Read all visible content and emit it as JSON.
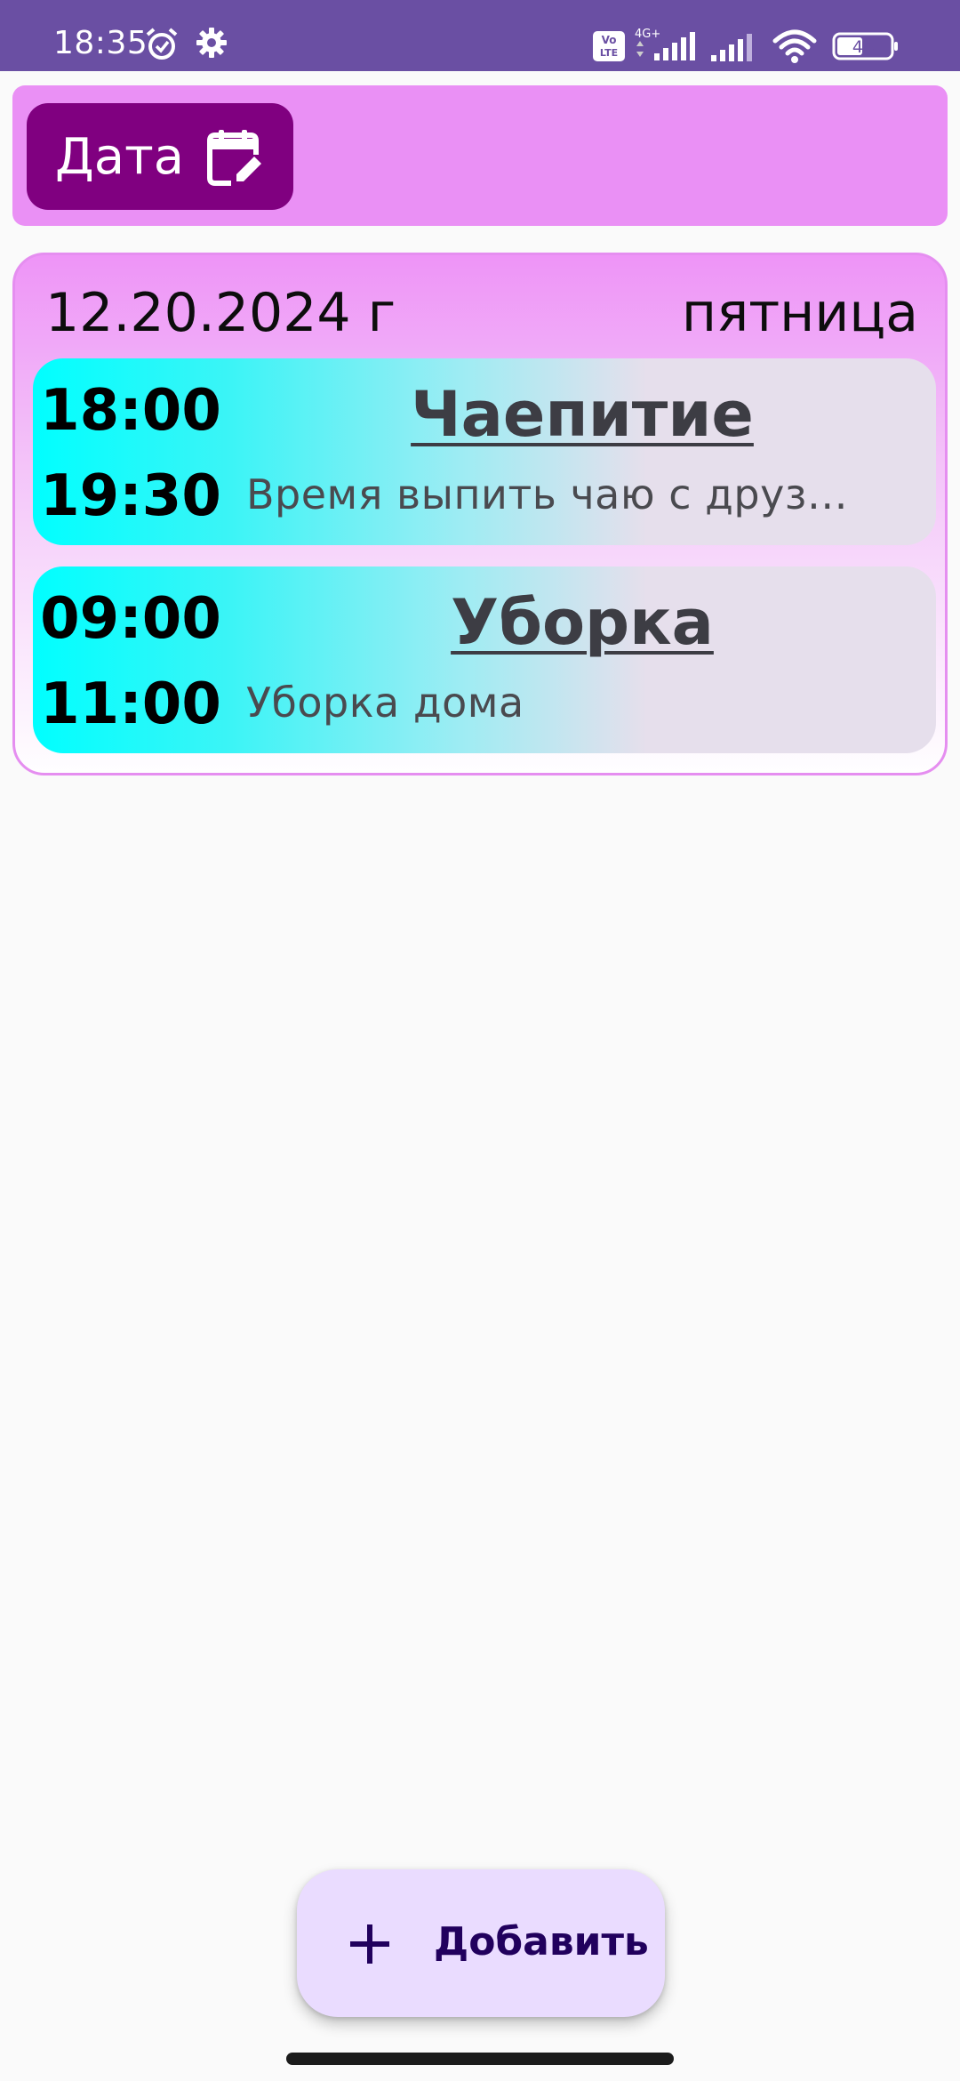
{
  "status_bar": {
    "time": "18:35",
    "network_label": "4G+",
    "volte_label": "Vo LTE",
    "battery_level": "44"
  },
  "header": {
    "date_button_label": "Дата"
  },
  "day": {
    "date": "12.20.2024 г",
    "weekday": "пятница",
    "events": [
      {
        "start": "18:00",
        "end": "19:30",
        "title": "Чаепитие",
        "description": "Время выпить чаю с друзьями"
      },
      {
        "start": "09:00",
        "end": "11:00",
        "title": "Уборка",
        "description": "Уборка дома"
      }
    ]
  },
  "fab": {
    "label": "Добавить"
  },
  "colors": {
    "status_bar": "#6a4fa3",
    "header_bg": "#ea90f5",
    "date_button": "#800080",
    "event_gradient_start": "#00ffff",
    "fab_bg": "#eadcff"
  },
  "icons": [
    "alarm-icon",
    "gear-icon",
    "volte-icon",
    "signal-icon",
    "wifi-icon",
    "battery-icon",
    "calendar-edit-icon",
    "plus-icon"
  ]
}
